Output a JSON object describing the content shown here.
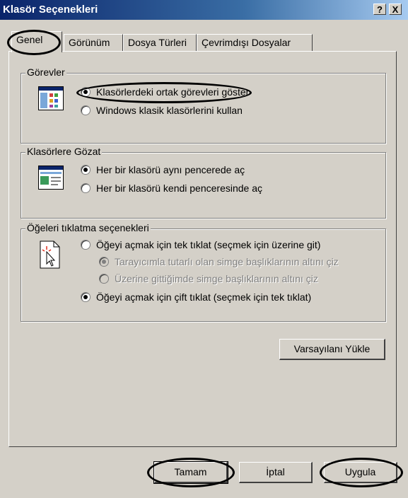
{
  "window": {
    "title": "Klasör Seçenekleri",
    "help_button": "?",
    "close_button": "X"
  },
  "tabs": [
    {
      "label": "Genel"
    },
    {
      "label": "Görünüm"
    },
    {
      "label": "Dosya Türleri"
    },
    {
      "label": "Çevrimdışı Dosyalar"
    }
  ],
  "groups": {
    "gorevler": {
      "title": "Görevler",
      "options": [
        {
          "label": "Klasörlerdeki ortak görevleri göster",
          "selected": true
        },
        {
          "label": "Windows klasik klasörlerini kullan",
          "selected": false
        }
      ]
    },
    "gozat": {
      "title": "Klasörlere Gözat",
      "options": [
        {
          "label": "Her bir klasörü aynı pencerede aç",
          "selected": true
        },
        {
          "label": "Her bir klasörü kendi penceresinde aç",
          "selected": false
        }
      ]
    },
    "tiklatma": {
      "title": "Öğeleri tıklatma seçenekleri",
      "options": [
        {
          "label": "Öğeyi açmak için tek tıklat (seçmek için üzerine git)",
          "selected": false
        },
        {
          "label": "Tarayıcımla tutarlı olan simge başlıklarının altını çiz",
          "selected": true,
          "disabled": true
        },
        {
          "label": "Üzerine gittiğimde simge başlıklarının altını çiz",
          "selected": false,
          "disabled": true
        },
        {
          "label": "Öğeyi açmak için çift tıklat (seçmek için tek tıklat)",
          "selected": true
        }
      ]
    }
  },
  "buttons": {
    "restore_defaults": "Varsayılanı Yükle",
    "ok": "Tamam",
    "cancel": "İptal",
    "apply": "Uygula"
  },
  "icons": {
    "tasks": "folder-tasks-icon",
    "browse": "window-browse-icon",
    "click": "cursor-click-icon"
  }
}
